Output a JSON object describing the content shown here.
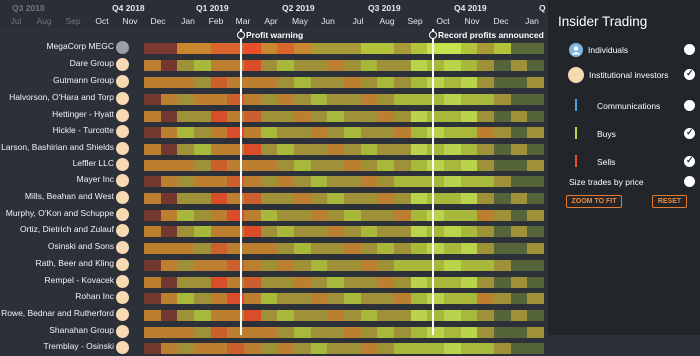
{
  "timeline": {
    "quarters": [
      {
        "label": "Q3  2018",
        "dim": true
      },
      {
        "label": "Q4  2018",
        "dim": false
      },
      {
        "label": "Q1  2019",
        "dim": false
      },
      {
        "label": "Q2  2019",
        "dim": false
      },
      {
        "label": "Q3  2019",
        "dim": false
      },
      {
        "label": "Q4  2019",
        "dim": false
      },
      {
        "label": "Q",
        "dim": false
      }
    ],
    "months": [
      {
        "label": "Jul",
        "dim": true
      },
      {
        "label": "Aug",
        "dim": true
      },
      {
        "label": "Sep",
        "dim": true
      },
      {
        "label": "Oct",
        "dim": false
      },
      {
        "label": "Nov",
        "dim": false
      },
      {
        "label": "Dec",
        "dim": false
      },
      {
        "label": "Jan",
        "dim": false
      },
      {
        "label": "Feb",
        "dim": false
      },
      {
        "label": "Mar",
        "dim": false
      },
      {
        "label": "Apr",
        "dim": false
      },
      {
        "label": "May",
        "dim": false
      },
      {
        "label": "Jun",
        "dim": false
      },
      {
        "label": "Jul",
        "dim": false
      },
      {
        "label": "Aug",
        "dim": false
      },
      {
        "label": "Sep",
        "dim": false
      },
      {
        "label": "Oct",
        "dim": false
      },
      {
        "label": "Nov",
        "dim": false
      },
      {
        "label": "Dec",
        "dim": false
      },
      {
        "label": "Jan",
        "dim": false
      }
    ],
    "annotations": [
      {
        "label": "Profit warning"
      },
      {
        "label": "Record profits announced"
      }
    ]
  },
  "nodes": [
    {
      "name": "MegaCorp MEGC",
      "kind": "company"
    },
    {
      "name": "Dare Group",
      "kind": "institution"
    },
    {
      "name": "Gutmann Group",
      "kind": "institution"
    },
    {
      "name": "Halvorson, O'Hara and Torp",
      "kind": "institution"
    },
    {
      "name": "Hettinger - Hyatt",
      "kind": "institution"
    },
    {
      "name": "Hickle - Turcotte",
      "kind": "institution"
    },
    {
      "name": "Larson, Bashirian and Shields",
      "kind": "institution"
    },
    {
      "name": "Leffler LLC",
      "kind": "institution"
    },
    {
      "name": "Mayer Inc",
      "kind": "institution"
    },
    {
      "name": "Mills, Beahan and West",
      "kind": "institution"
    },
    {
      "name": "Murphy, O'Kon and Schuppe",
      "kind": "institution"
    },
    {
      "name": "Ortiz, Dietrich and Zulauf",
      "kind": "institution"
    },
    {
      "name": "Osinski and Sons",
      "kind": "institution"
    },
    {
      "name": "Rath, Beer and Kling",
      "kind": "institution"
    },
    {
      "name": "Rempel - Kovacek",
      "kind": "institution"
    },
    {
      "name": "Rohan Inc",
      "kind": "institution"
    },
    {
      "name": "Rowe, Bednar and Rutherford",
      "kind": "institution"
    },
    {
      "name": "Shanahan Group",
      "kind": "institution"
    },
    {
      "name": "Tremblay - Osinski",
      "kind": "institution"
    }
  ],
  "colors": {
    "sell_strong": "#e8502a",
    "sell": "#d9642e",
    "mid_orange": "#c9862f",
    "mid": "#a99a38",
    "buy": "#b3c43c",
    "buy_strong": "#c6e24c",
    "dim_red": "#7a3a30",
    "dim_green": "#5a6a3a",
    "accent": "#f08a3e",
    "communications": "#4aa3df"
  },
  "panel": {
    "title": "Insider Trading",
    "items": [
      {
        "label": "Individuals",
        "icon": "person-icon",
        "checked": false
      },
      {
        "label": "Institutional investors",
        "icon": "institution-icon",
        "checked": true
      },
      {
        "label": "Communications",
        "icon": "communications-bar-icon",
        "checked": false
      },
      {
        "label": "Buys",
        "icon": "buys-bar-icon",
        "checked": true
      },
      {
        "label": "Sells",
        "icon": "sells-bar-icon",
        "checked": true
      }
    ],
    "size_by_price": {
      "label": "Size trades by price",
      "checked": false
    },
    "zoom_label": "ZOOM TO FIT",
    "reset_label": "RESET"
  }
}
